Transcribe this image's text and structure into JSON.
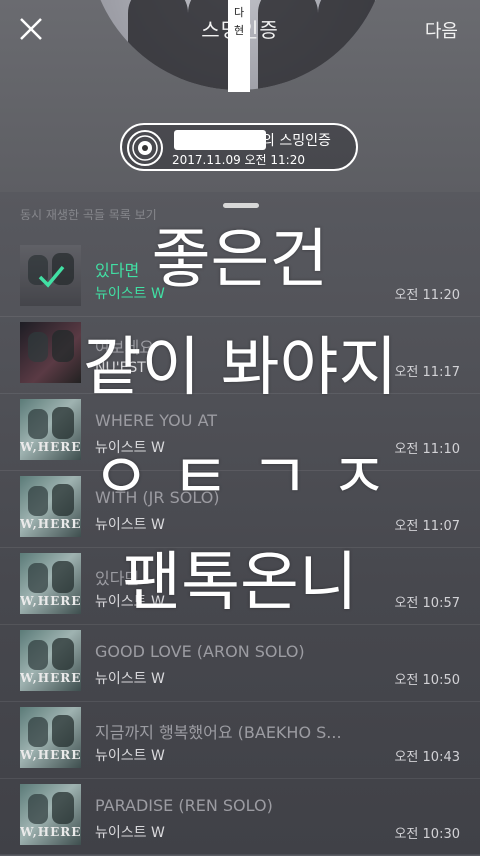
{
  "header": {
    "title": "스밍인증",
    "vertical_tag": "다\n현",
    "next_label": "다음",
    "auth_suffix": "의 스밍인증",
    "auth_time": "2017.11.09 오전 11:20"
  },
  "sheet": {
    "subtitle": "동시 재생한 곡들 목록 보기"
  },
  "songs": [
    {
      "title": "있다면",
      "artist": "뉴이스트 W",
      "time": "오전 11:20"
    },
    {
      "title": "여보세요",
      "artist": "NU'EST",
      "time": "오전 11:17"
    },
    {
      "title": "WHERE YOU AT",
      "artist": "뉴이스트 W",
      "time": "오전 11:10"
    },
    {
      "title": "WITH (JR SOLO)",
      "artist": "뉴이스트 W",
      "time": "오전 11:07"
    },
    {
      "title": "있다면",
      "artist": "뉴이스트 W",
      "time": "오전 10:57"
    },
    {
      "title": "GOOD LOVE (ARON SOLO)",
      "artist": "뉴이스트 W",
      "time": "오전 10:50"
    },
    {
      "title": "지금까지 행복했어요 (BAEKHO S...",
      "artist": "뉴이스트 W",
      "time": "오전 10:43"
    },
    {
      "title": "PARADISE (REN SOLO)",
      "artist": "뉴이스트 W",
      "time": "오전 10:30"
    }
  ],
  "album_label": "W,HERE",
  "caption": {
    "line1": "좋은건",
    "line2": "같이 봐야지",
    "line3": "ㅇ ㅌ ㄱ ㅈ",
    "line4": "팬톡온니"
  },
  "colors": {
    "accent": "#41e0a4",
    "sheet_bg": "#4d4f56"
  }
}
